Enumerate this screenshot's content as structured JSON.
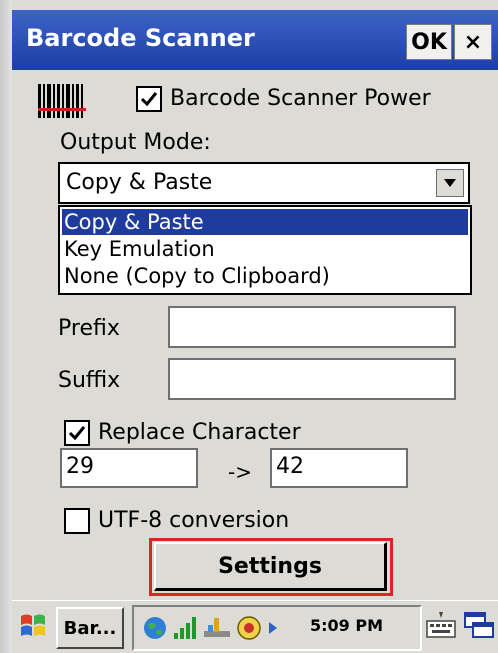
{
  "window": {
    "title": "Barcode Scanner",
    "ok_label": "OK",
    "close_label": "×"
  },
  "power": {
    "label": "Barcode Scanner Power",
    "checked": true
  },
  "output_mode": {
    "label": "Output Mode:",
    "selected": "Copy & Paste",
    "options": [
      "Copy & Paste",
      "Key Emulation",
      "None (Copy to Clipboard)"
    ]
  },
  "prefix": {
    "label": "Prefix",
    "value": ""
  },
  "suffix": {
    "label": "Suffix",
    "value": ""
  },
  "replace": {
    "label": "Replace Character",
    "checked": true,
    "from": "29",
    "arrow": "->",
    "to": "42"
  },
  "utf8": {
    "label": "UTF-8 conversion",
    "checked": false
  },
  "settings_button": {
    "label": "Settings"
  },
  "taskbar": {
    "app_label": "Bar...",
    "clock": "5:09 PM"
  },
  "colors": {
    "titlebar": "#2a4fbf",
    "selection": "#1f3b9e",
    "highlight_outline": "#e02424"
  }
}
